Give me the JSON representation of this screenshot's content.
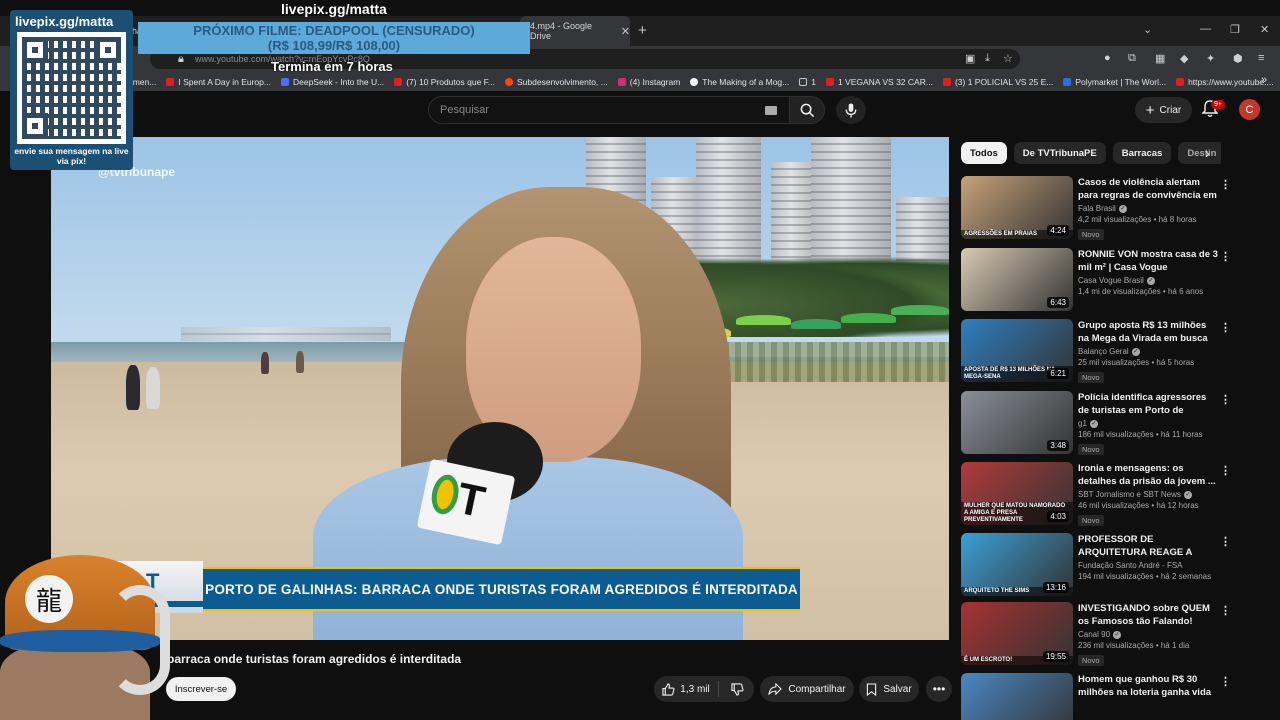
{
  "browser": {
    "tabs": [
      {
        "label": "ha",
        "active": false
      },
      {
        "label": "4.mp4 - Google Drive",
        "active": true
      }
    ],
    "url": "www.youtube.com/watch?v=mEopYcvPc8Q",
    "bookmarks": [
      {
        "label": "amen...",
        "color": "#e74c3c"
      },
      {
        "label": "I Spent A Day in Europ...",
        "color": "#e02020"
      },
      {
        "label": "DeepSeek - Into the U...",
        "color": "#4d6bfe"
      },
      {
        "label": "(7) 10 Produtos que F...",
        "color": "#e02020"
      },
      {
        "label": "Subdesenvolvimento, ...",
        "color": "#ff4500"
      },
      {
        "label": "(4) Instagram",
        "color": "#d62976"
      },
      {
        "label": "The Making of a Mog...",
        "color": "#ffffff"
      },
      {
        "label": "1",
        "color": "#c8a14a"
      },
      {
        "label": "1 VEGANA VS 32 CAR...",
        "color": "#e02020"
      },
      {
        "label": "(3) 1 POLICIAL VS 25 E...",
        "color": "#e02020"
      },
      {
        "label": "Polymarket | The Worl...",
        "color": "#2b6ee6"
      },
      {
        "label": "https://www.youtube....",
        "color": "#e02020"
      }
    ]
  },
  "yt": {
    "search_placeholder": "Pesquisar",
    "create_label": "Criar",
    "notif_count": "9+",
    "avatar_letter": "C"
  },
  "video": {
    "watermark": "@tvtribunape",
    "lower_third": "PORTO DE GALINHAS: BARRACA ONDE TURISTAS FORAM AGREDIDOS É INTERDITADA",
    "title": "barraca onde turistas foram agredidos é interditada",
    "subscribe_label": "Inscrever-se",
    "likes": "1,3 mil",
    "share_label": "Compartilhar",
    "save_label": "Salvar"
  },
  "chips": [
    "Todos",
    "De TVTribunaPE",
    "Barracas",
    "Destin"
  ],
  "recommendations": [
    {
      "title": "Casos de violência alertam para regras de convivência em prai...",
      "channel": "Fala Brasil",
      "verified": true,
      "views": "4,2 mil visualizações • há 8 horas",
      "badge": "Novo",
      "duration": "4:24",
      "thumb": "#c7a27a",
      "thumb_caption": "AGRESSÕES EM PRAIAS"
    },
    {
      "title": "RONNIE VON mostra casa de 3 mil m² | Casa Vogue",
      "channel": "Casa Vogue Brasil",
      "verified": true,
      "views": "1,4 mi de visualizações • há 6 anos",
      "badge": "",
      "duration": "6:43",
      "thumb": "#d9cbb3",
      "thumb_caption": ""
    },
    {
      "title": "Grupo aposta R$ 13 milhões na Mega da Virada em busca de ...",
      "channel": "Balanço Geral",
      "verified": true,
      "views": "25 mil visualizações • há 5 horas",
      "badge": "Novo",
      "duration": "6:21",
      "thumb": "#2f7fc1",
      "thumb_caption": "APOSTA DE R$ 13 MILHÕES NA MEGA-SENA"
    },
    {
      "title": "Polícia identifica agressores de turistas em Porto de Galinhas ...",
      "channel": "g1",
      "verified": true,
      "views": "186 mil visualizações • há 11 horas",
      "badge": "Novo",
      "duration": "3:48",
      "thumb": "#8a8f99",
      "thumb_caption": ""
    },
    {
      "title": "Ironia e mensagens: os detalhes da prisão da jovem ...",
      "channel": "SBT Jornalismo e SBT News",
      "verified": true,
      "views": "46 mil visualizações • há 12 horas",
      "badge": "Novo",
      "duration": "4:03",
      "thumb": "#b23a3a",
      "thumb_caption": "MULHER QUE MATOU NAMORADO A AMIGA E PRESA PREVENTIVAMENTE"
    },
    {
      "title": "PROFESSOR DE ARQUITETURA REAGE A CASAS NO THE SIM...",
      "channel": "Fundação Santo André - FSA",
      "verified": false,
      "views": "194 mil visualizações • há 2 semanas",
      "badge": "",
      "duration": "13:16",
      "thumb": "#3aa0d8",
      "thumb_caption": "ARQUITETO THE SIMS"
    },
    {
      "title": "INVESTIGANDO sobre QUEM os Famosos tão Falando!",
      "channel": "Canal 90",
      "verified": true,
      "views": "236 mil visualizações • há 1 dia",
      "badge": "Novo",
      "duration": "19:55",
      "thumb": "#a83232",
      "thumb_caption": "É UM ESCROTO!"
    },
    {
      "title": "Homem que ganhou R$ 30 milhões na loteria ganha vida ...",
      "channel": "",
      "verified": false,
      "views": "",
      "badge": "",
      "duration": "",
      "thumb": "#4a87c4",
      "thumb_caption": ""
    }
  ],
  "overlay": {
    "site": "livepix.gg/matta",
    "top_site": "livepix.gg/matta",
    "next_film_l1": "PRÓXIMO FILME: DEADPOOL (CENSURADO)",
    "next_film_l2": "(R$ 108,99/R$ 108,00)",
    "ends_in": "Termina em 7 horas",
    "qr_message": "envie sua mensagem na live via pix!",
    "cap_glyph": "龍"
  }
}
